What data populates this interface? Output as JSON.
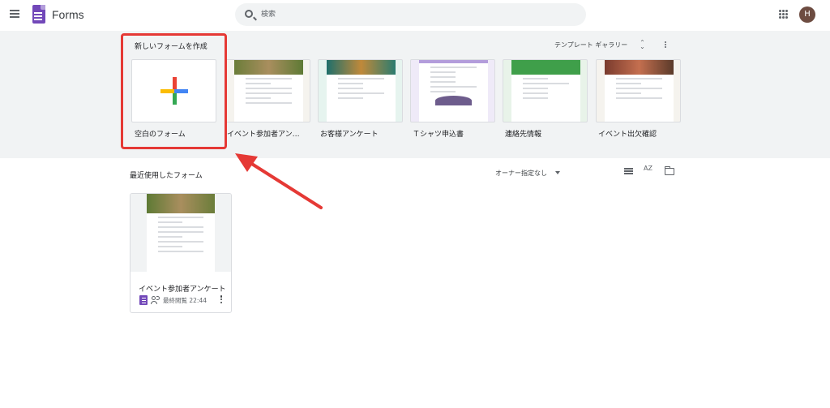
{
  "header": {
    "app_title": "Forms",
    "search_placeholder": "検索",
    "avatar_initial": "H"
  },
  "gallery": {
    "title": "新しいフォームを作成",
    "gallery_link": "テンプレート ギャラリー",
    "templates": [
      {
        "label": "空白のフォーム",
        "kind": "blank"
      },
      {
        "label": "イベント参加者アンケート",
        "kind": "event-feedback",
        "color": "#f5f3ee"
      },
      {
        "label": "お客様アンケート",
        "kind": "customer-feedback",
        "color": "#e6f4ef"
      },
      {
        "label": "Ｔシャツ申込書",
        "kind": "tshirt",
        "color": "#efeaf8"
      },
      {
        "label": "連絡先情報",
        "kind": "contact",
        "color": "#e8f3e9"
      },
      {
        "label": "イベント出欠確認",
        "kind": "rsvp",
        "color": "#f5f3ee"
      }
    ]
  },
  "recent": {
    "title": "最近使用したフォーム",
    "owner_filter": "オーナー指定なし",
    "sort_label": "AZ",
    "forms": [
      {
        "name": "イベント参加者アンケート",
        "meta": "最終閲覧 22:44"
      }
    ]
  },
  "colors": {
    "accent": "#7248b9",
    "highlight": "#e53935"
  }
}
